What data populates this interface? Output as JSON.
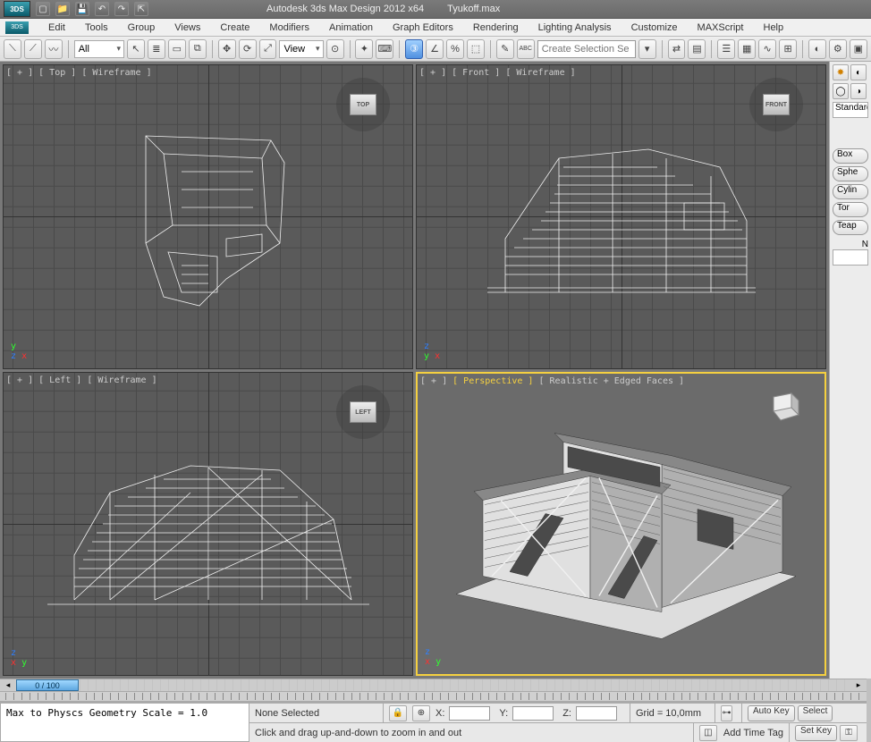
{
  "app": {
    "logo_text": "3DS",
    "title": "Autodesk 3ds Max Design 2012 x64",
    "filename": "Tyukoff.max"
  },
  "menus": [
    "Edit",
    "Tools",
    "Group",
    "Views",
    "Create",
    "Modifiers",
    "Animation",
    "Graph Editors",
    "Rendering",
    "Lighting Analysis",
    "Customize",
    "MAXScript",
    "Help"
  ],
  "toolbar": {
    "filter_label": "All",
    "view_label": "View",
    "selection_set_placeholder": "Create Selection Se"
  },
  "viewports": {
    "top": {
      "label_parts": [
        "[ + ]",
        "[ Top ]",
        "[ Wireframe ]"
      ],
      "cube": "TOP"
    },
    "front": {
      "label_parts": [
        "[ + ]",
        "[ Front ]",
        "[ Wireframe ]"
      ],
      "cube": "FRONT"
    },
    "left": {
      "label_parts": [
        "[ + ]",
        "[ Left ]",
        "[ Wireframe ]"
      ],
      "cube": "LEFT"
    },
    "persp": {
      "label_parts": [
        "[ + ]",
        "[ Perspective ]",
        "[ Realistic + Edged Faces ]"
      ],
      "highlight_index": 1
    }
  },
  "command_panel": {
    "dropdown": "Standard",
    "primitives": [
      "Box",
      "Sphe",
      "Cylin",
      "Tor",
      "Teap"
    ],
    "name_label": "N"
  },
  "timeline": {
    "thumb": "0 / 100"
  },
  "status": {
    "selection": "None Selected",
    "x_label": "X:",
    "y_label": "Y:",
    "z_label": "Z:",
    "x": "",
    "y": "",
    "z": "",
    "grid": "Grid = 10,0mm",
    "tip": "Click and drag up-and-down to zoom in and out",
    "add_time_tag": "Add Time Tag",
    "auto_key": "Auto Key",
    "set_key": "Set Key",
    "select_label": "Select"
  },
  "script_log": "Max to Physcs Geometry Scale = 1.0"
}
